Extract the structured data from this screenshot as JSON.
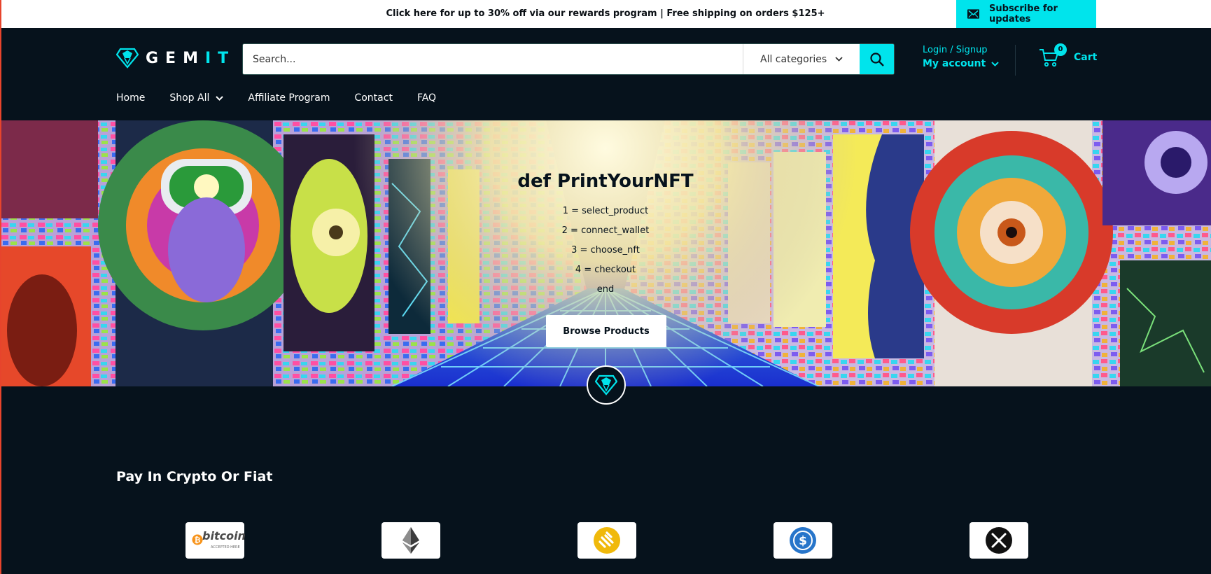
{
  "announcement": {
    "text": "Click here for up to 30% off via our rewards program | Free shipping on orders $125+",
    "subscribe_label": "Subscribe for updates"
  },
  "header": {
    "logo": {
      "prefix": "GEM",
      "suffix": "IT"
    },
    "search": {
      "placeholder": "Search...",
      "category": "All categories"
    },
    "account": {
      "login": "Login / Signup",
      "my_account": "My account"
    },
    "cart": {
      "count": "0",
      "label": "Cart"
    },
    "nav": [
      "Home",
      "Shop All",
      "Affiliate Program",
      "Contact",
      "FAQ"
    ]
  },
  "hero": {
    "title": "def PrintYourNFT",
    "lines": [
      "1 = select_product",
      "2 = connect_wallet",
      "3 = choose_nft",
      "4 = checkout",
      "end"
    ],
    "button": "Browse Products"
  },
  "pay": {
    "title": "Pay In Crypto Or Fiat",
    "logos": [
      {
        "icon": "bitcoin-icon",
        "text": "bitcoin",
        "subtext": "ACCEPTED HERE"
      },
      {
        "icon": "ethereum-icon"
      },
      {
        "icon": "binance-usd-icon"
      },
      {
        "icon": "usdc-icon"
      },
      {
        "icon": "xrp-icon"
      }
    ]
  },
  "colors": {
    "accent": "#00e4ec",
    "background": "#06121c"
  }
}
